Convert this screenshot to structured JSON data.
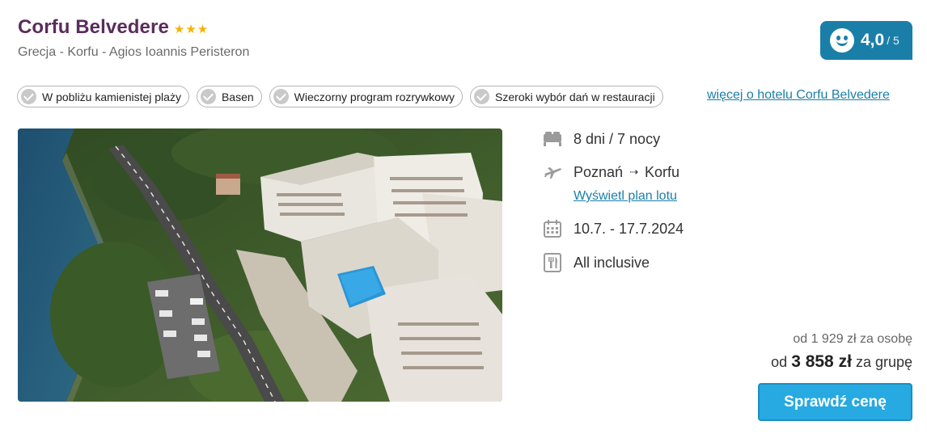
{
  "hotel": {
    "name": "Corfu Belvedere",
    "stars": [
      "★",
      "★",
      "★"
    ],
    "location": "Grecja - Korfu - Agios Ioannis Peristeron"
  },
  "rating": {
    "value": "4,0",
    "max": "/ 5",
    "icon": "smiley-icon",
    "color": "#1a7fa8"
  },
  "tags": [
    {
      "label": "W pobliżu kamienistej plaży",
      "icon": "check-icon"
    },
    {
      "label": "Basen",
      "icon": "check-icon"
    },
    {
      "label": "Wieczorny program rozrywkowy",
      "icon": "check-icon"
    },
    {
      "label": "Szeroki wybór dań w restauracji",
      "icon": "check-icon"
    }
  ],
  "more_link": "więcej o hotelu Corfu Belvedere",
  "trip": {
    "duration": "8 dni / 7 nocy",
    "from": "Poznań",
    "arrow": "⇢",
    "to": "Korfu",
    "flight_plan_link": "Wyświetl plan lotu",
    "dates": "10.7. - 17.7.2024",
    "board": "All inclusive"
  },
  "price": {
    "per_person": "od 1 929 zł za osobę",
    "group_prefix": "od",
    "group_amount": "3 858 zł",
    "group_suffix": "za grupę"
  },
  "cta": {
    "label": "Sprawdź cenę",
    "color": "#27a9e1"
  }
}
